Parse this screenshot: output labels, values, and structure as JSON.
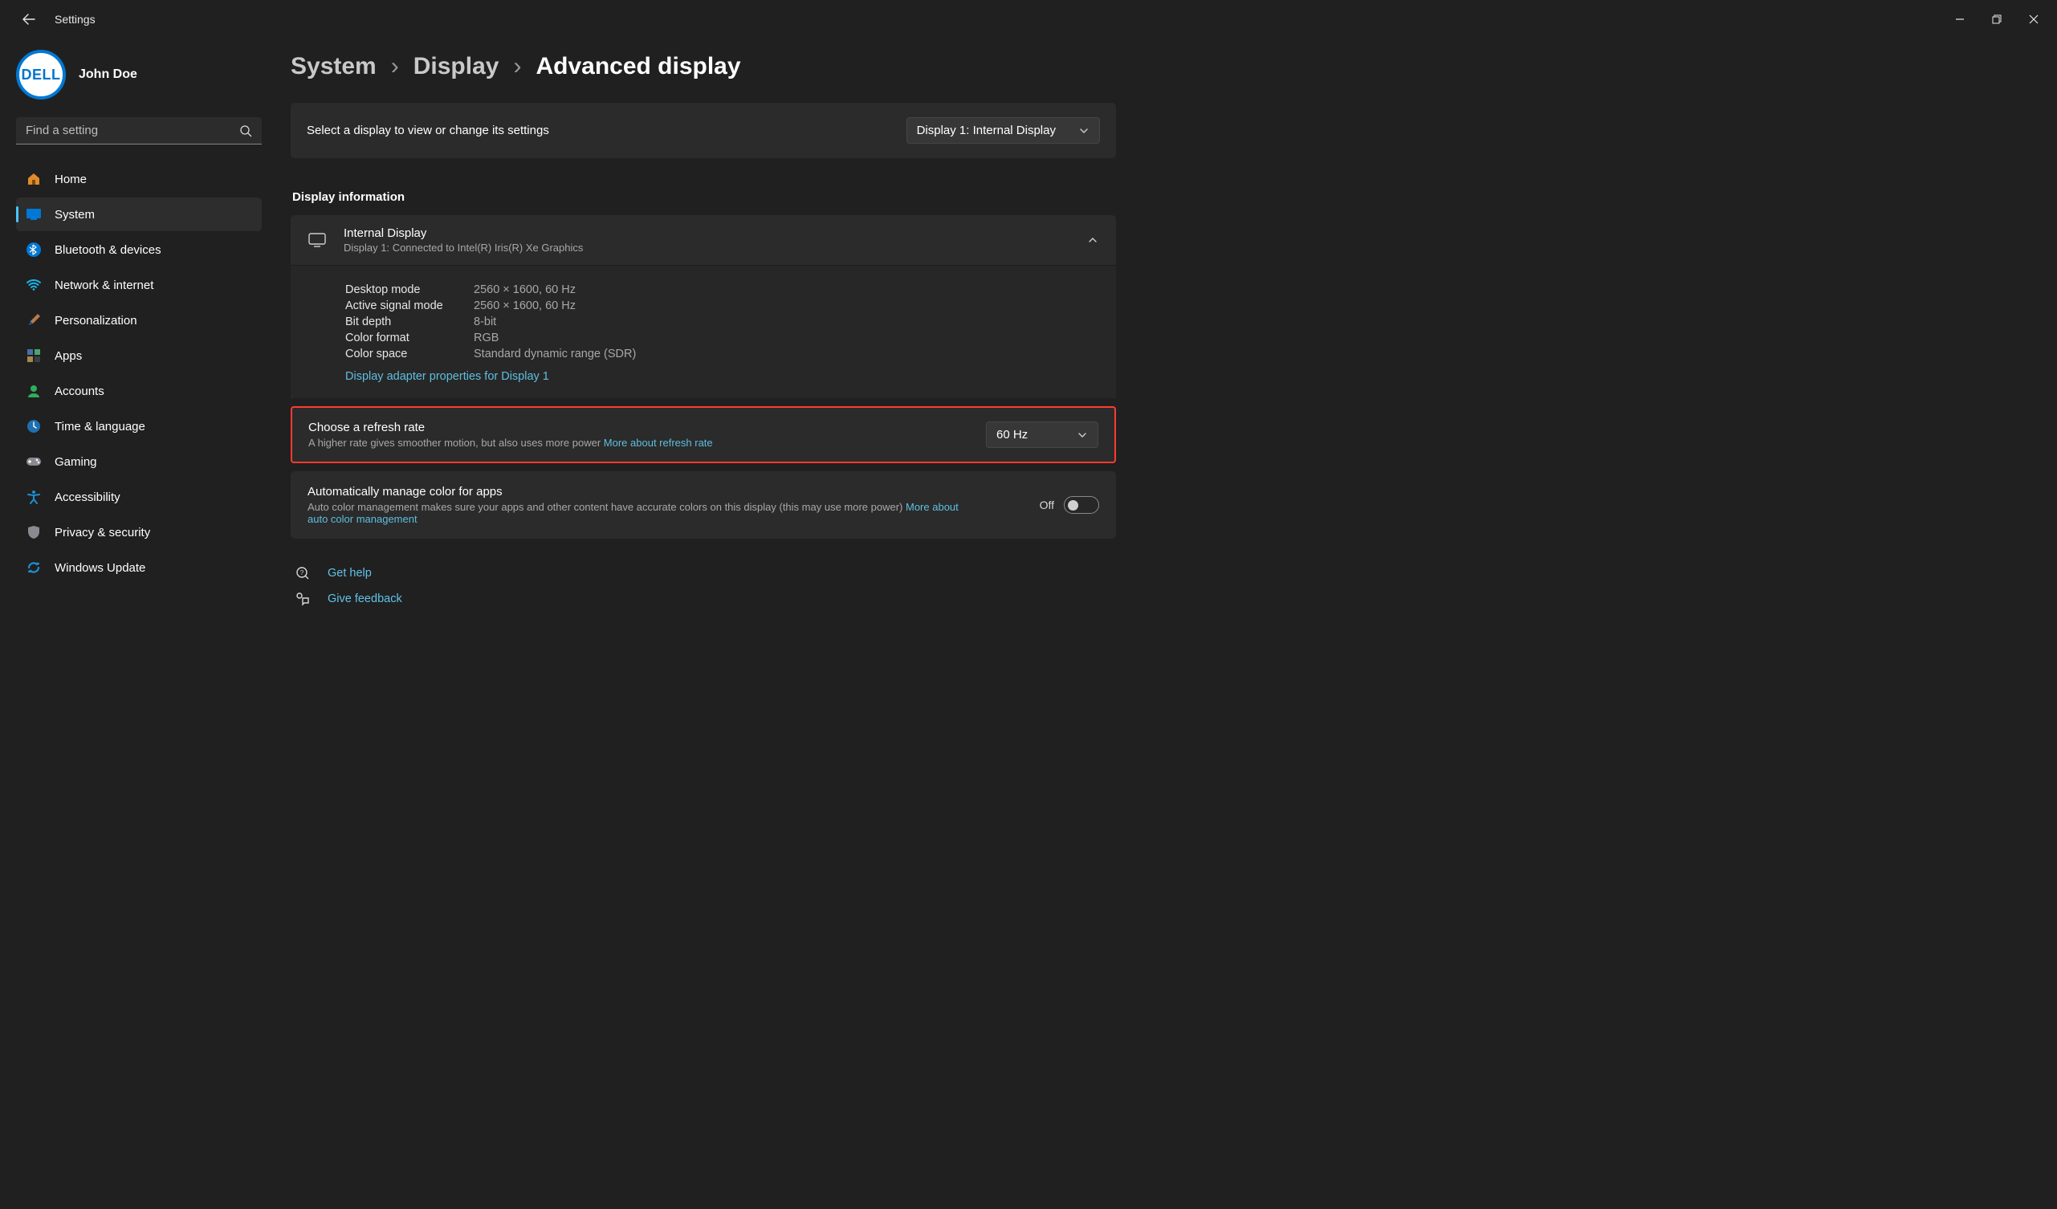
{
  "app": {
    "name": "Settings",
    "user_name": "John Doe",
    "avatar_text": "DELL"
  },
  "search": {
    "placeholder": "Find a setting"
  },
  "sidebar": {
    "items": [
      {
        "label": "Home"
      },
      {
        "label": "System"
      },
      {
        "label": "Bluetooth & devices"
      },
      {
        "label": "Network & internet"
      },
      {
        "label": "Personalization"
      },
      {
        "label": "Apps"
      },
      {
        "label": "Accounts"
      },
      {
        "label": "Time & language"
      },
      {
        "label": "Gaming"
      },
      {
        "label": "Accessibility"
      },
      {
        "label": "Privacy & security"
      },
      {
        "label": "Windows Update"
      }
    ],
    "active_index": 1
  },
  "breadcrumb": {
    "a": "System",
    "b": "Display",
    "c": "Advanced display"
  },
  "selector": {
    "label": "Select a display to view or change its settings",
    "value": "Display 1: Internal Display"
  },
  "display_info": {
    "heading": "Display information",
    "title": "Internal Display",
    "subtitle": "Display 1: Connected to Intel(R) Iris(R) Xe Graphics",
    "rows": [
      {
        "k": "Desktop mode",
        "v": "2560 × 1600, 60 Hz"
      },
      {
        "k": "Active signal mode",
        "v": "2560 × 1600, 60 Hz"
      },
      {
        "k": "Bit depth",
        "v": "8-bit"
      },
      {
        "k": "Color format",
        "v": "RGB"
      },
      {
        "k": "Color space",
        "v": "Standard dynamic range (SDR)"
      }
    ],
    "adapter_link": "Display adapter properties for Display 1"
  },
  "refresh": {
    "title": "Choose a refresh rate",
    "subtitle_a": "A higher rate gives smoother motion, but also uses more power  ",
    "subtitle_link": "More about refresh rate",
    "value": "60 Hz"
  },
  "auto_color": {
    "title": "Automatically manage color for apps",
    "subtitle_a": "Auto color management makes sure your apps and other content have accurate colors on this display (this may use more power) ",
    "subtitle_link": "More about auto color management",
    "state_label": "Off"
  },
  "footer": {
    "help": "Get help",
    "feedback": "Give feedback"
  }
}
